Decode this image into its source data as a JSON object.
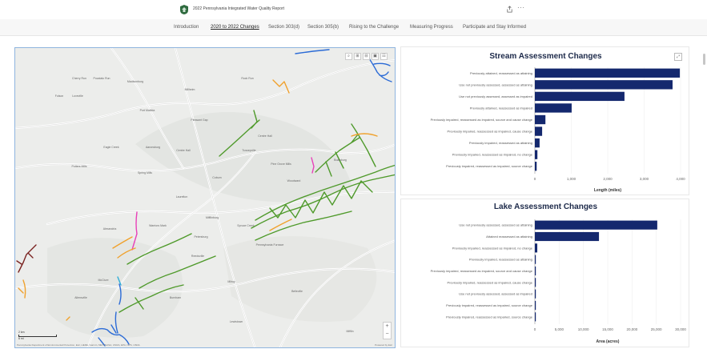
{
  "header": {
    "title": "2022 Pennsylvania Integrated Water Quality Report",
    "more": "···"
  },
  "nav": {
    "items": [
      {
        "label": "Introduction",
        "active": false
      },
      {
        "label": "2020 to 2022 Changes",
        "active": true
      },
      {
        "label": "Section 303(d)",
        "active": false
      },
      {
        "label": "Section 305(b)",
        "active": false
      },
      {
        "label": "Rising to the Challenge",
        "active": false
      },
      {
        "label": "Measuring Progress",
        "active": false
      },
      {
        "label": "Participate and Stay Informed",
        "active": false
      }
    ]
  },
  "map": {
    "tools": [
      "⌕",
      "⊞",
      "⊟",
      "▣",
      "☷"
    ],
    "zoom_in": "+",
    "zoom_out": "−",
    "scale_top": "2 km",
    "scale_bottom": "6 mi",
    "attribution": "Pennsylvania Department of Environmental Protection, Esri, HERE, Garmin, METI/NASA, USGS, EPA, NPS, USDA",
    "powered_by": "Powered by Esri",
    "places": [
      "Cherry Run",
      "Pocatalo Run",
      "Madisonburg",
      "Millheim",
      "Rock Run",
      "Fulson",
      "Loveville",
      "Port Matilda",
      "Pleasant Gap",
      "Centre Hall",
      "Eagle Creek",
      "Aaronsburg",
      "Centre Hall",
      "Tusseyville",
      "Pine Grove Mills",
      "Boalsburg",
      "Potters Mills",
      "Spring Mills",
      "Coburn",
      "Woodward",
      "Laurelton",
      "Mifflinburg",
      "Spruce Creek",
      "Pennsylvania Furnace",
      "Alexandria",
      "Warriors Mark",
      "Petersburg",
      "Reedsville",
      "Milroy",
      "Belleville",
      "McClure",
      "Allensville",
      "Burnham",
      "Lewistown",
      "Mifflin"
    ]
  },
  "colors": {
    "bar": "#14286e",
    "stream_green": "#4f9a2b",
    "stream_orange": "#f0a12c",
    "stream_blue": "#2b6bd6",
    "stream_pink": "#e83fb8",
    "stream_darkred": "#7a2321",
    "stream_teal": "#2eaed8"
  },
  "chart_data": [
    {
      "type": "bar",
      "orientation": "horizontal",
      "title": "Stream Assessment Changes",
      "xlabel": "Length (miles)",
      "xlim": [
        0,
        4000
      ],
      "xticks": [
        "0",
        "1,000",
        "2,000",
        "3,000",
        "4,000"
      ],
      "categories": [
        "Previously attained, reassessed as attaining",
        "Use not previously assessed, assessed as attaining",
        "Use not previously assessed, assessed as impaired",
        "Previously attained, reassessed as impaired",
        "Previously impaired, reassessed as impaired, source and cause change",
        "Previously impaired, reassessed as impaired, cause change",
        "Previously impaired, reassessed as attaining",
        "Previously impaired, reassessed as impaired, no change",
        "Previously impaired, reassessed as impaired, source change"
      ],
      "values": [
        3980,
        3780,
        2460,
        1010,
        290,
        200,
        130,
        70,
        50
      ]
    },
    {
      "type": "bar",
      "orientation": "horizontal",
      "title": "Lake Assessment Changes",
      "xlabel": "Area (acres)",
      "xlim": [
        0,
        30000
      ],
      "xticks": [
        "0",
        "5,000",
        "10,000",
        "15,000",
        "20,000",
        "25,000",
        "30,000"
      ],
      "categories": [
        "Use not previously assessed, assessed as attaining",
        "Attained reassessed as attaining",
        "Previously impaired, reassessed as impaired, no change",
        "Previously impaired, reassessed as attaining",
        "Previously impaired, reassessed as impaired, source and cause change",
        "Previously impaired, reassessed as impaired, cause change",
        "Use not previously assessed, assessed as impaired",
        "Previously impaired, reassessed as impaired, source change",
        "Previously impaired, reassessed as impaired, source change"
      ],
      "values": [
        25200,
        13200,
        500,
        130,
        80,
        60,
        50,
        30,
        20
      ]
    }
  ]
}
